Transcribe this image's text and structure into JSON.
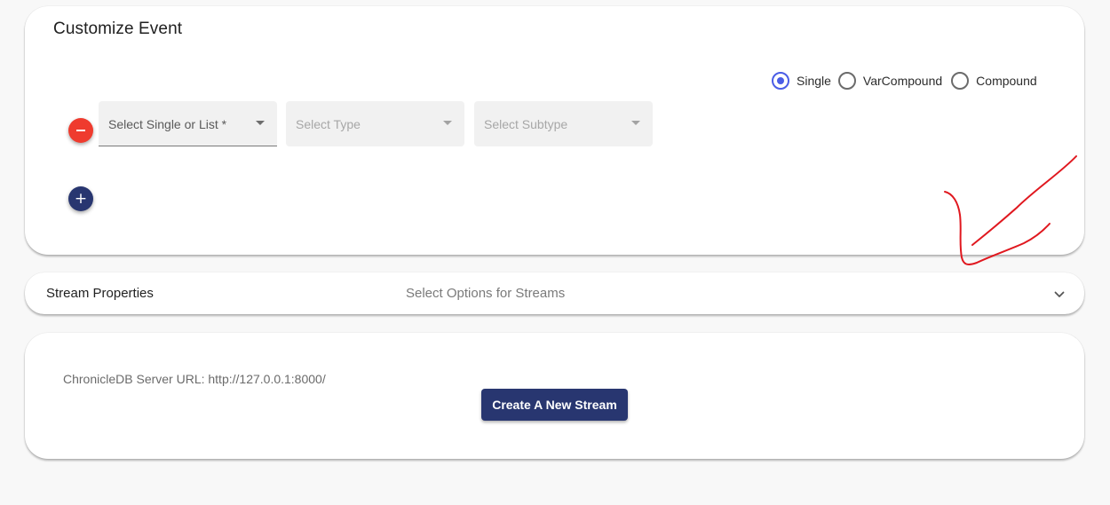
{
  "colors": {
    "background": "#f8f8f8",
    "card": "#ffffff",
    "primary": "#283670",
    "radio_accent": "#4a5de6",
    "remove": "#ef3b2e",
    "annotation": "#e0181f"
  },
  "event_card": {
    "title": "Customize Event",
    "event_kind": {
      "selected": "Single",
      "options": [
        "Single",
        "VarCompound",
        "Compound"
      ]
    },
    "remove_icon": "minus-icon",
    "add_icon": "plus-icon",
    "fields": {
      "single_or_list": {
        "label": "Select Single or List *"
      },
      "type": {
        "label": "Select Type"
      },
      "subtype": {
        "label": "Select Subtype"
      }
    }
  },
  "stream_properties": {
    "title": "Stream Properties",
    "hint": "Select Options for Streams",
    "expand_icon": "chevron-down-icon"
  },
  "server": {
    "url_label": "ChronicleDB Server URL: http://127.0.0.1:8000/",
    "create_button": "Create A New Stream"
  },
  "annotation": {
    "kind": "hand-drawn-arrow",
    "color": "#e0181f"
  }
}
